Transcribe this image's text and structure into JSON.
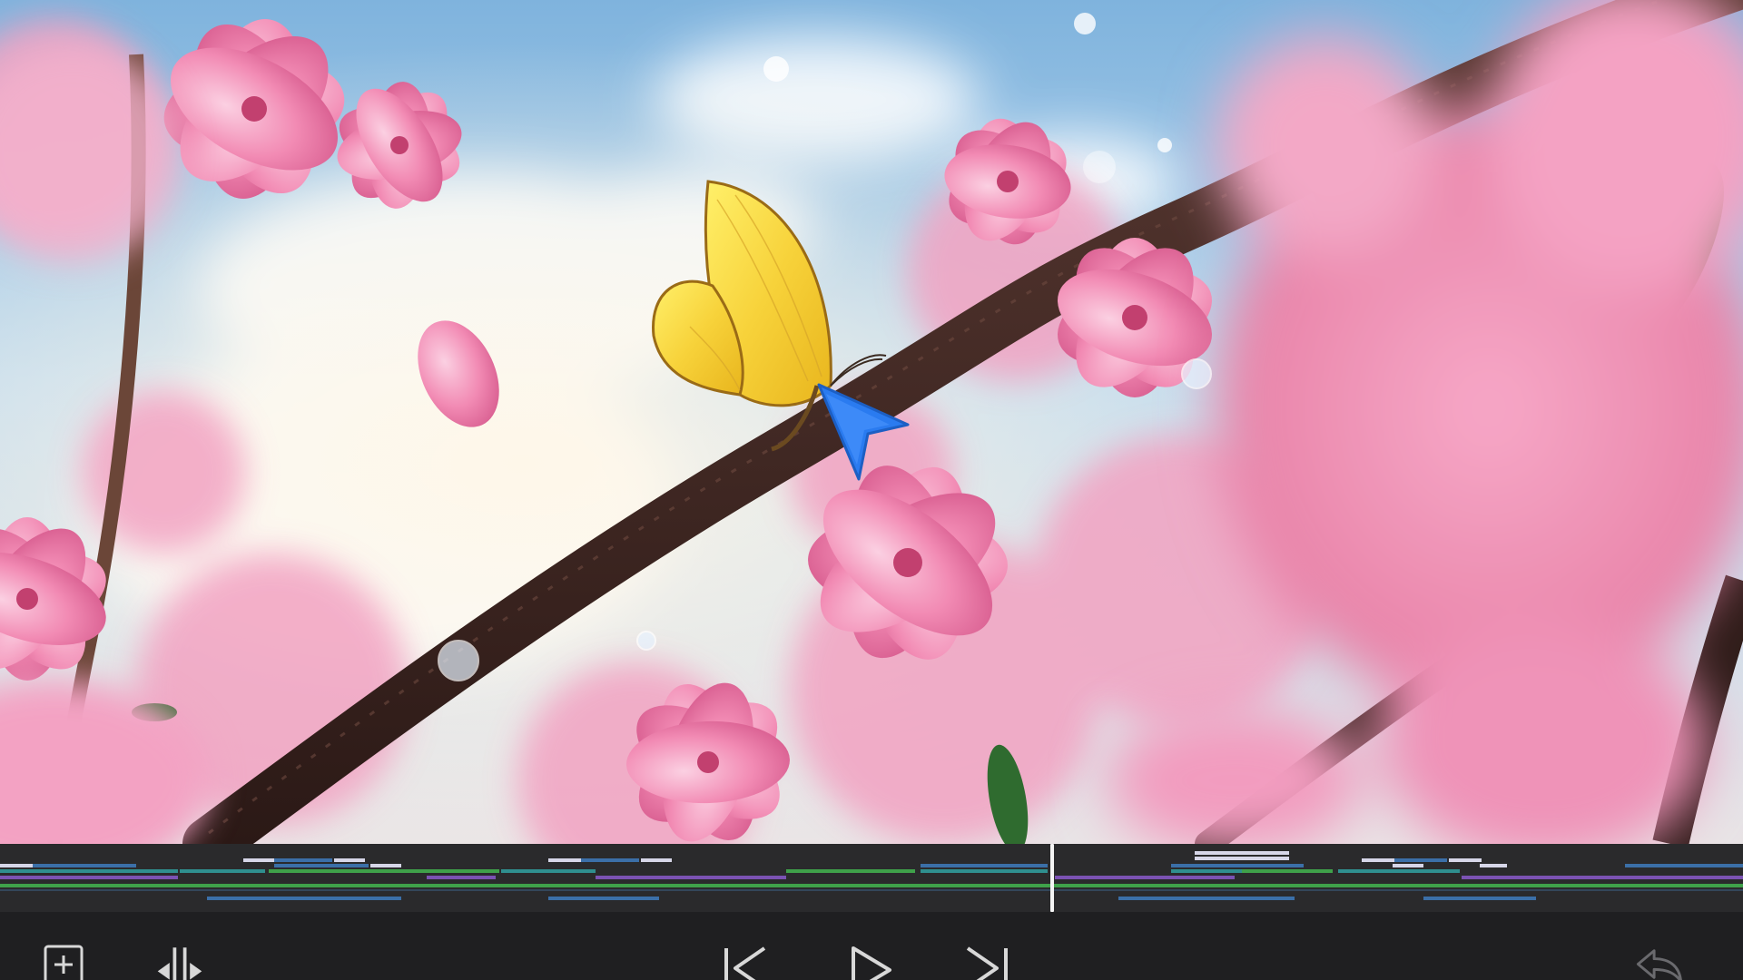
{
  "app": {
    "screen": "video-editor-preview"
  },
  "viewer": {
    "content": "cherry-blossom-butterfly-scene",
    "cursor_icon": "pointer-arrow-icon",
    "colors": {
      "sky": "#a8cde8",
      "blossom": "#f28bb4",
      "butterfly": "#f7d23a",
      "branch": "#3a2320",
      "cursor": "#2a7bf0"
    }
  },
  "timeline": {
    "colors": {
      "background": "#2a2a2c",
      "track_blue": "#3b6fa8",
      "track_teal": "#2f8f8f",
      "track_purple": "#7b52b3",
      "track_green": "#3fa14a",
      "track_light": "#d6d6e8",
      "playhead": "#f4f4f4"
    }
  },
  "toolbar": {
    "add_clip_icon": "add-square-icon",
    "split_icon": "split-clip-icon",
    "skip_back_icon": "skip-to-start-icon",
    "play_icon": "play-icon",
    "skip_forward_icon": "skip-to-end-icon",
    "undo_icon": "undo-arrow-icon"
  }
}
